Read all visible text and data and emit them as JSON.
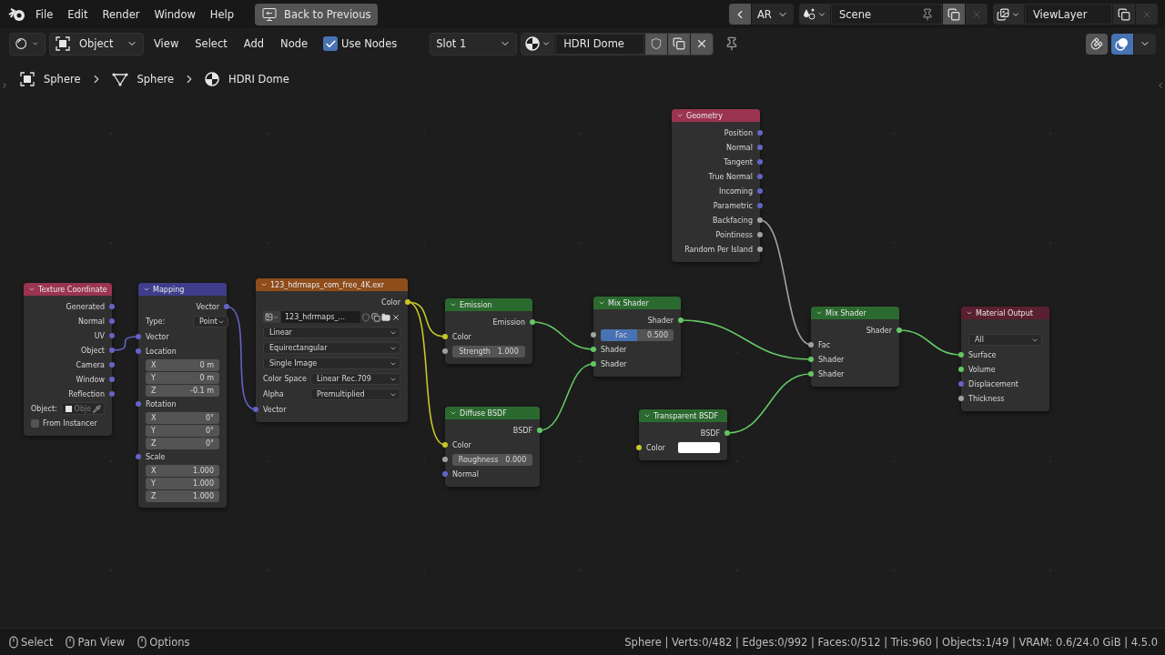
{
  "menu": [
    "File",
    "Edit",
    "Render",
    "Window",
    "Help"
  ],
  "back_button": "Back to Previous",
  "workspace": {
    "label": "AR"
  },
  "scene": {
    "name": "Scene"
  },
  "view_layer": {
    "name": "ViewLayer"
  },
  "header": {
    "mode": "Object",
    "menus": [
      "View",
      "Select",
      "Add",
      "Node"
    ],
    "use_nodes": {
      "label": "Use Nodes",
      "checked": true
    },
    "slot": "Slot 1",
    "material": "HDRI Dome",
    "overlay_toggle": {
      "on": true
    }
  },
  "breadcrumbs": [
    {
      "kind": "object",
      "label": "Sphere"
    },
    {
      "kind": "mesh",
      "label": "Sphere"
    },
    {
      "kind": "material",
      "label": "HDRI Dome"
    }
  ],
  "nodes": [
    {
      "title": "Texture Coordinate",
      "kind": "input",
      "rows": [
        {
          "kind": "out",
          "label": "Generated",
          "socket": {
            "color": "#6363c7"
          }
        },
        {
          "kind": "out",
          "label": "Normal",
          "socket": {
            "color": "#6363c7"
          }
        },
        {
          "kind": "out",
          "label": "UV",
          "socket": {
            "color": "#6363c7"
          }
        },
        {
          "kind": "out",
          "label": "Object",
          "socket": {
            "color": "#6363c7"
          }
        },
        {
          "kind": "out",
          "label": "Camera",
          "socket": {
            "color": "#6363c7"
          }
        },
        {
          "kind": "out",
          "label": "Window",
          "socket": {
            "color": "#6363c7"
          }
        },
        {
          "kind": "out",
          "label": "Reflection",
          "socket": {
            "color": "#6363c7"
          }
        },
        {
          "kind": "object",
          "label": "Object:",
          "placeholder": "Obje"
        },
        {
          "kind": "checkbox",
          "label": "From Instancer",
          "checked": false
        }
      ]
    },
    {
      "title": "Mapping",
      "kind": "vector",
      "rows": [
        {
          "kind": "out",
          "label": "Vector",
          "socket": {
            "color": "#6363c7"
          }
        },
        {
          "kind": "dropdown",
          "label": "Type:",
          "value": "Point"
        },
        {
          "kind": "in",
          "label": "Vector",
          "socket": {
            "color": "#6363c7"
          }
        },
        {
          "kind": "in",
          "label": "Location",
          "socket": {
            "color": "#6363c7"
          }
        },
        {
          "kind": "vec",
          "label": "X",
          "value": "0 m"
        },
        {
          "kind": "vec",
          "label": "Y",
          "value": "0 m"
        },
        {
          "kind": "vec",
          "label": "Z",
          "value": "-0.1 m"
        },
        {
          "kind": "in",
          "label": "Rotation",
          "socket": {
            "color": "#6363c7"
          }
        },
        {
          "kind": "vec",
          "label": "X",
          "value": "0°"
        },
        {
          "kind": "vec",
          "label": "Y",
          "value": "0°"
        },
        {
          "kind": "vec",
          "label": "Z",
          "value": "0°"
        },
        {
          "kind": "in",
          "label": "Scale",
          "socket": {
            "color": "#6363c7"
          }
        },
        {
          "kind": "vec",
          "label": "X",
          "value": "1.000"
        },
        {
          "kind": "vec",
          "label": "Y",
          "value": "1.000"
        },
        {
          "kind": "vec",
          "label": "Z",
          "value": "1.000"
        }
      ]
    },
    {
      "title": "123_hdrmaps_com_free_4K.exr",
      "kind": "texture",
      "rows": [
        {
          "kind": "out",
          "label": "Color",
          "socket": {
            "color": "#c7c729"
          }
        },
        {
          "kind": "image",
          "value": "123_hdrmaps_..."
        },
        {
          "kind": "dropdown",
          "value": "Linear"
        },
        {
          "kind": "dropdown",
          "value": "Equirectangular"
        },
        {
          "kind": "dropdown",
          "value": "Single Image"
        },
        {
          "kind": "dropdown",
          "label": "Color Space",
          "value": "Linear Rec.709"
        },
        {
          "kind": "dropdown",
          "label": "Alpha",
          "value": "Premultiplied"
        },
        {
          "kind": "in",
          "label": "Vector",
          "socket": {
            "color": "#6363c7"
          }
        }
      ]
    },
    {
      "title": "Emission",
      "kind": "shader",
      "rows": [
        {
          "kind": "out",
          "label": "Emission",
          "socket": {
            "color": "#63c763"
          }
        },
        {
          "kind": "in",
          "label": "Color",
          "socket": {
            "color": "#c7c729"
          }
        },
        {
          "kind": "value",
          "label": "Strength",
          "value": "1.000",
          "socket": {
            "color": "#a1a1a1"
          }
        }
      ]
    },
    {
      "title": "Diffuse BSDF",
      "kind": "shader",
      "rows": [
        {
          "kind": "out",
          "label": "BSDF",
          "socket": {
            "color": "#63c763"
          }
        },
        {
          "kind": "in",
          "label": "Color",
          "socket": {
            "color": "#c7c729"
          }
        },
        {
          "kind": "value",
          "label": "Roughness",
          "value": "0.000",
          "socket": {
            "color": "#a1a1a1"
          }
        },
        {
          "kind": "in",
          "label": "Normal",
          "socket": {
            "color": "#6363c7"
          }
        }
      ]
    },
    {
      "title": "Mix Shader",
      "kind": "shader",
      "rows": [
        {
          "kind": "out",
          "label": "Shader",
          "socket": {
            "color": "#63c763"
          }
        },
        {
          "kind": "slider",
          "label": "Fac",
          "value": "0.500",
          "level": 0.5,
          "socket": {
            "color": "#a1a1a1"
          }
        },
        {
          "kind": "in",
          "label": "Shader",
          "socket": {
            "color": "#63c763"
          }
        },
        {
          "kind": "in",
          "label": "Shader",
          "socket": {
            "color": "#63c763"
          }
        }
      ]
    },
    {
      "title": "Geometry",
      "kind": "input",
      "rows": [
        {
          "kind": "out",
          "label": "Position",
          "socket": {
            "color": "#6363c7"
          }
        },
        {
          "kind": "out",
          "label": "Normal",
          "socket": {
            "color": "#6363c7"
          }
        },
        {
          "kind": "out",
          "label": "Tangent",
          "socket": {
            "color": "#6363c7"
          }
        },
        {
          "kind": "out",
          "label": "True Normal",
          "socket": {
            "color": "#6363c7"
          }
        },
        {
          "kind": "out",
          "label": "Incoming",
          "socket": {
            "color": "#6363c7"
          }
        },
        {
          "kind": "out",
          "label": "Parametric",
          "socket": {
            "color": "#6363c7"
          }
        },
        {
          "kind": "out",
          "label": "Backfacing",
          "socket": {
            "color": "#a1a1a1"
          }
        },
        {
          "kind": "out",
          "label": "Pointiness",
          "socket": {
            "color": "#a1a1a1"
          }
        },
        {
          "kind": "out",
          "label": "Random Per Island",
          "socket": {
            "color": "#a1a1a1"
          }
        }
      ]
    },
    {
      "title": "Transparent BSDF",
      "kind": "shader",
      "rows": [
        {
          "kind": "out",
          "label": "BSDF",
          "socket": {
            "color": "#63c763"
          }
        },
        {
          "kind": "color",
          "label": "Color",
          "socket": {
            "color": "#c7c729"
          },
          "color": "#ffffff"
        }
      ]
    },
    {
      "title": "Mix Shader",
      "kind": "shader",
      "rows": [
        {
          "kind": "out",
          "label": "Shader",
          "socket": {
            "color": "#63c763"
          }
        },
        {
          "kind": "in",
          "label": "Fac",
          "socket": {
            "color": "#a1a1a1"
          }
        },
        {
          "kind": "in",
          "label": "Shader",
          "socket": {
            "color": "#63c763"
          }
        },
        {
          "kind": "in",
          "label": "Shader",
          "socket": {
            "color": "#63c763"
          }
        }
      ]
    },
    {
      "title": "Material Output",
      "kind": "output",
      "rows": [
        {
          "kind": "dropdown",
          "value": "All"
        },
        {
          "kind": "in",
          "label": "Surface",
          "socket": {
            "color": "#63c763"
          }
        },
        {
          "kind": "in",
          "label": "Volume",
          "socket": {
            "color": "#63c763"
          }
        },
        {
          "kind": "in",
          "label": "Displacement",
          "socket": {
            "color": "#6363c7"
          }
        },
        {
          "kind": "in",
          "label": "Thickness",
          "socket": {
            "color": "#a1a1a1"
          }
        }
      ]
    }
  ],
  "status": {
    "hints": [
      "Select",
      "Pan View",
      "Options"
    ],
    "stats": "Sphere | Verts:0/482 | Edges:0/992 | Faces:0/512 | Tris:960 | Objects:1/49 | VRAM: 0.6/24.0 GiB | 4.5.0"
  }
}
